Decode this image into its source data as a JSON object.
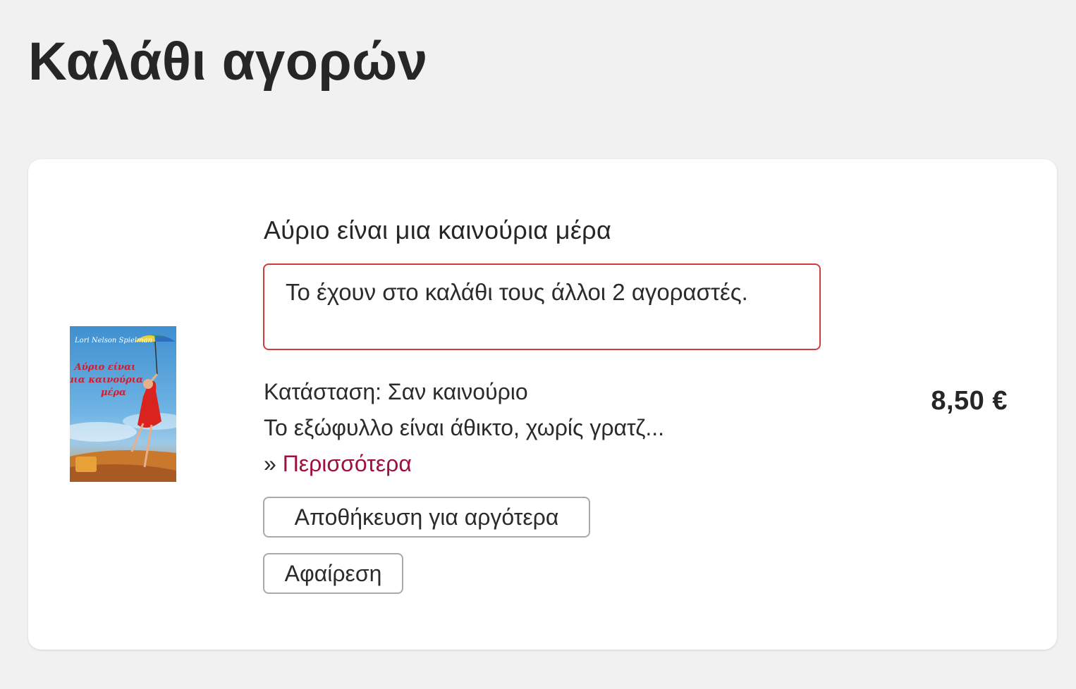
{
  "page": {
    "title": "Καλάθι αγορών"
  },
  "cart_item": {
    "title": "Αύριο είναι μια καινούρια μέρα",
    "demand_notice": "Το έχουν στο καλάθι τους άλλοι 2 αγοραστές.",
    "condition": "Κατάσταση: Σαν καινούριο",
    "description": "Το εξώφυλλο είναι άθικτο, χωρίς γρατζ...",
    "more_prefix": "» ",
    "more_label": "Περισσότερα",
    "price": "8,50 €",
    "save_label": "Αποθήκευση για αργότερα",
    "remove_label": "Αφαίρεση",
    "cover": {
      "author": "Lori Nelson Spielman",
      "title_line1": "Αύριο είναι",
      "title_line2": "μια καινούρια",
      "title_line3": "μέρα"
    }
  },
  "colors": {
    "background": "#f1f1f1",
    "card": "#ffffff",
    "notice_border": "#d33a3a",
    "link": "#a0103c",
    "button_border": "#a9a9a9"
  }
}
